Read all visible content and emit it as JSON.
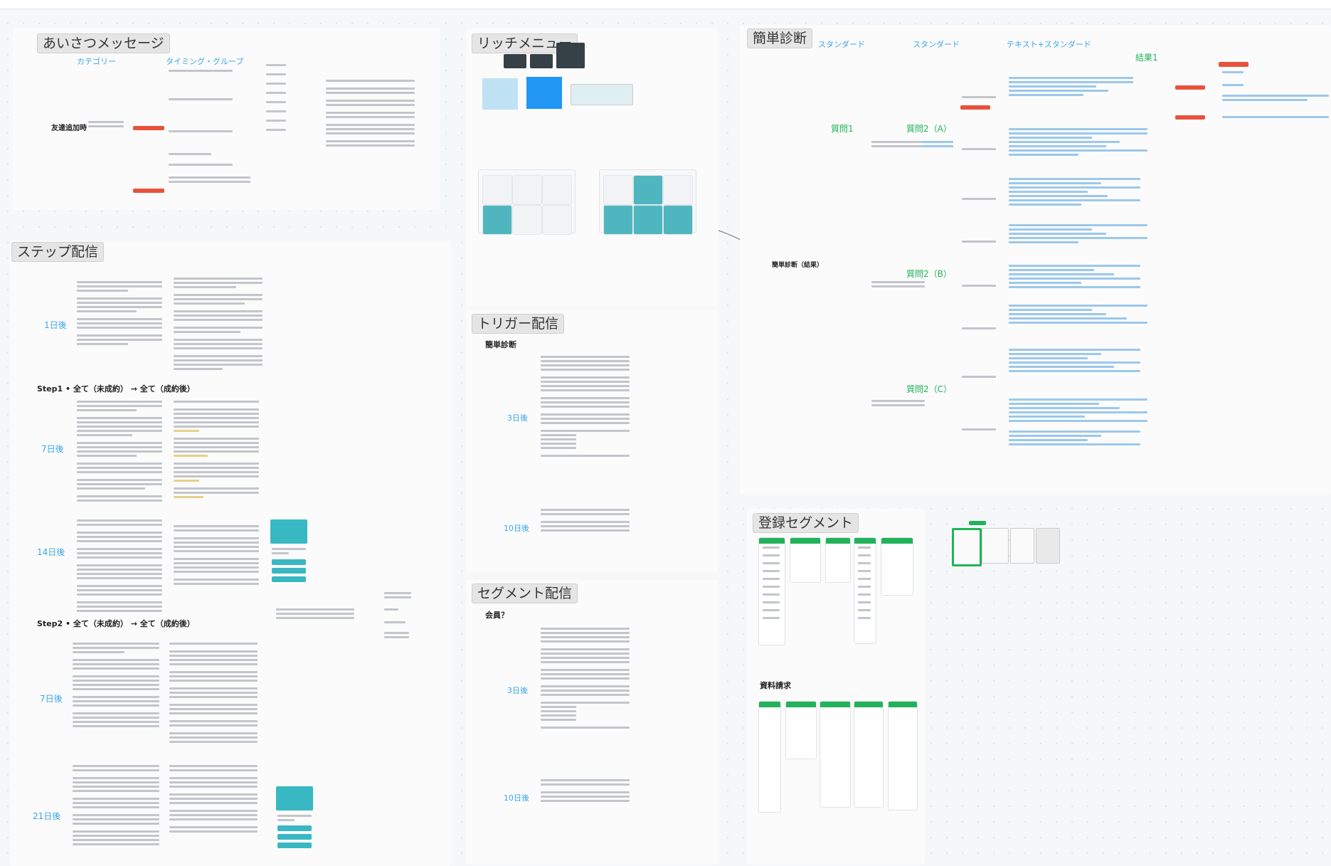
{
  "app": {
    "name": "whiteboard-canvas"
  },
  "frames": {
    "greeting": {
      "title": "あいさつメッセージ",
      "col_a": "カテゴリー",
      "col_b": "タイミング・グループ",
      "root": "友達追加時"
    },
    "rich_menu": {
      "title": "リッチメニュー"
    },
    "diagnosis": {
      "title": "簡単診断",
      "col_1": "スタンダード",
      "col_2": "スタンダード",
      "col_3": "テキスト+スタンダード",
      "result_label": "結果1",
      "q1": "質問1",
      "q2a": "質問2（A）",
      "q2b": "質問2（B）",
      "q2c": "質問2（C）",
      "root": "簡単診断（結果）"
    },
    "step": {
      "title": "ステップ配信",
      "day1": "1日後",
      "section1": "Step1 • 全て（未成約） → 全て（成約後）",
      "day7a": "7日後",
      "day14": "14日後",
      "section2": "Step2 • 全て（未成約） → 全て（成約後）",
      "day7b": "7日後",
      "day21": "21日後"
    },
    "trigger": {
      "title": "トリガー配信",
      "subtitle": "簡単診断",
      "d3": "3日後",
      "d10": "10日後"
    },
    "segment": {
      "title": "セグメント配信",
      "subtitle": "会員？",
      "d3": "3日後",
      "d10": "10日後"
    },
    "registration": {
      "title": "登録セグメント",
      "materials": "資料請求"
    }
  }
}
